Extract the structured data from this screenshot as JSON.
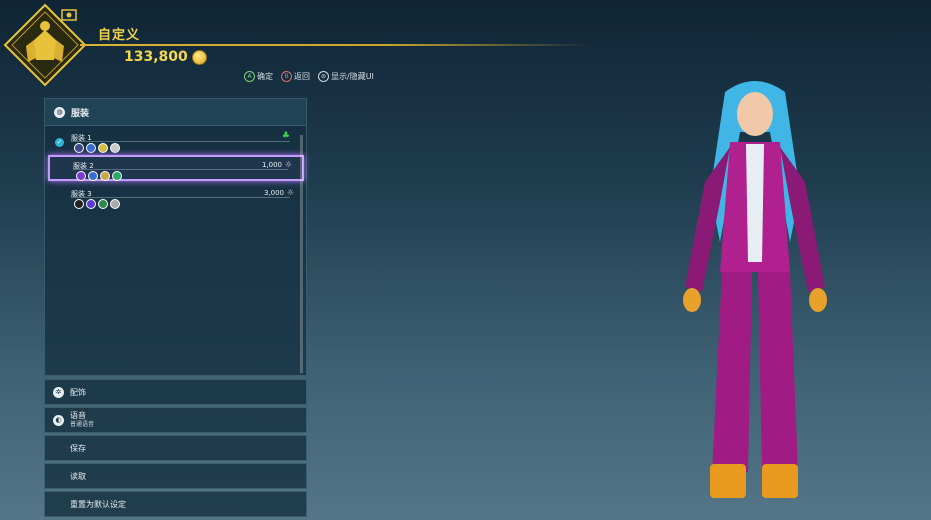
{
  "header": {
    "title": "自定义",
    "money": "133,800"
  },
  "hints": [
    {
      "key": "A",
      "label": "确定"
    },
    {
      "key": "B",
      "label": "返回"
    },
    {
      "key": "⊜",
      "label": "显示/隐藏UI"
    }
  ],
  "outfit_panel": {
    "title": "服装",
    "items": [
      {
        "label": "服装 1",
        "price": "",
        "equipped": true
      },
      {
        "label": "服装 2",
        "price": "1,000"
      },
      {
        "label": "服装 3",
        "price": "3,000"
      }
    ]
  },
  "menu": {
    "accessories": "配饰",
    "voice": "语音",
    "voice_value": "普通语音",
    "save": "保存",
    "load": "读取",
    "reset": "重置为默认设定"
  },
  "colors": {
    "accent_gold": "#f3d34a",
    "selection": "#c59bff",
    "equipped": "#2bb4d6"
  }
}
